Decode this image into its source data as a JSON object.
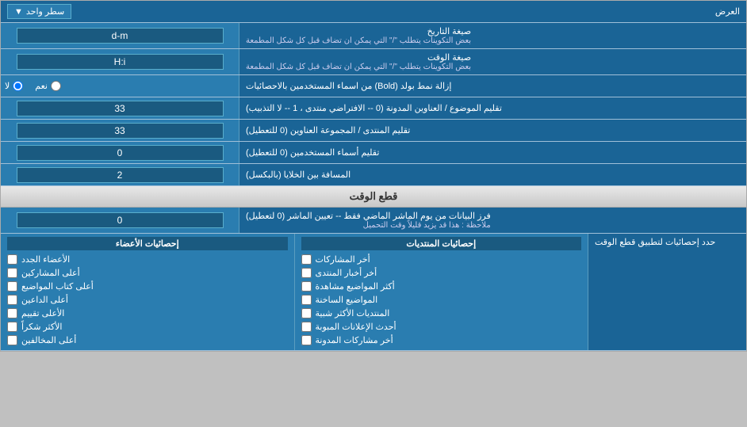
{
  "header": {
    "label": "العرض",
    "dropdown_label": "سطر واحد",
    "dropdown_icon": "▼"
  },
  "rows": [
    {
      "id": "date_format",
      "label": "صيغة التاريخ",
      "sublabel": "بعض التكوينات يتطلب \"/\" التي يمكن ان تضاف قبل كل شكل المطمعة",
      "value": "d-m"
    },
    {
      "id": "time_format",
      "label": "صيغة الوقت",
      "sublabel": "بعض التكوينات يتطلب \"/\" التي يمكن ان تضاف قبل كل شكل المطمعة",
      "value": "H:i"
    },
    {
      "id": "bold_remove",
      "label": "إزالة نمط بولد (Bold) من اسماء المستخدمين بالاحصائيات",
      "radio_yes": "نعم",
      "radio_no": "لا",
      "default": "no"
    },
    {
      "id": "topics_titles",
      "label": "تقليم الموضوع / العناوين المدونة (0 -- الافتراضي منتدى ، 1 -- لا التذبيب)",
      "value": "33"
    },
    {
      "id": "forum_titles",
      "label": "تقليم المنتدى / المجموعة العناوين (0 للتعطيل)",
      "value": "33"
    },
    {
      "id": "usernames",
      "label": "تقليم أسماء المستخدمين (0 للتعطيل)",
      "value": "0"
    },
    {
      "id": "spacing",
      "label": "المسافة بين الخلايا (بالبكسل)",
      "value": "2"
    }
  ],
  "cutoff_section": {
    "title": "قطع الوقت",
    "row": {
      "label": "فرز البيانات من يوم الماشر الماضي فقط -- تعيين الماشر (0 لتعطيل)",
      "sublabel": "ملاحظة : هذا قد يزيد قليلاً وقت التحميل",
      "value": "0"
    },
    "stats_header_label": "حدد إحصائيات لتطبيق قطع الوقت"
  },
  "stats": {
    "left_panel_label": "حدد إحصائيات لتطبيق قطع الوقت",
    "columns": [
      {
        "id": "post_stats",
        "header": "إحصائيات المنتديات",
        "items": [
          "أخر المشاركات",
          "أخر أخبار المنتدى",
          "أكثر المواضيع مشاهدة",
          "المواضيع الساخنة",
          "المنتديات الأكثر شبية",
          "أحدث الإعلانات المبوبة",
          "أخر مشاركات المدونة"
        ]
      },
      {
        "id": "member_stats",
        "header": "إحصائيات الأعضاء",
        "items": [
          "الأعضاء الجدد",
          "أعلى المشاركين",
          "أعلى كتاب المواضيع",
          "أعلى الداعين",
          "الأعلى تقييم",
          "الأكثر شكراً",
          "أعلى المخالفين"
        ]
      }
    ]
  }
}
